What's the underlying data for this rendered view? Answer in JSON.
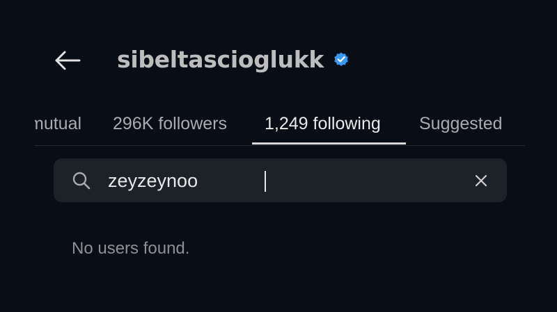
{
  "header": {
    "back_icon": "arrow-left-icon",
    "username": "sibeltascioglukk",
    "verified_icon": "verified-badge-icon",
    "verified_color": "#3897f0"
  },
  "tabs": [
    {
      "label": "mutual",
      "active": false
    },
    {
      "label": "296K followers",
      "active": false
    },
    {
      "label": "1,249 following",
      "active": true
    },
    {
      "label": "Suggested",
      "active": false
    }
  ],
  "search": {
    "icon": "search-icon",
    "value": "zeyzeynoo",
    "clear_icon": "close-icon"
  },
  "results": {
    "empty_message": "No users found."
  },
  "colors": {
    "background": "#090d15",
    "search_background": "#1d2128",
    "active_tab_indicator": "#d8d8d8"
  }
}
